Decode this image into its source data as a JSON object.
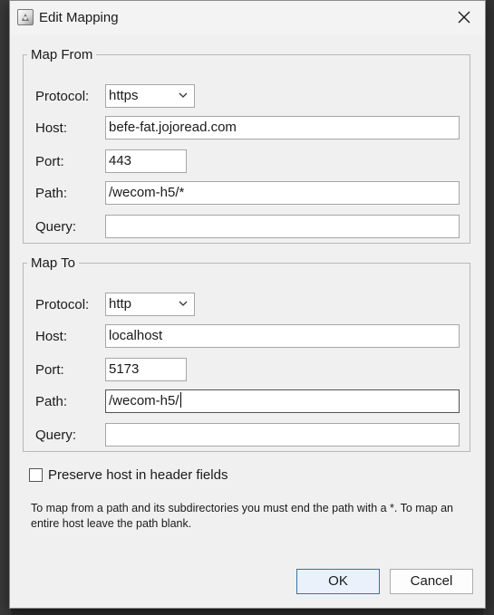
{
  "dialog": {
    "title": "Edit Mapping"
  },
  "map_from": {
    "legend": "Map From",
    "protocol_label": "Protocol:",
    "protocol_value": "https",
    "host_label": "Host:",
    "host_value": "befe-fat.jojoread.com",
    "port_label": "Port:",
    "port_value": "443",
    "path_label": "Path:",
    "path_value": "/wecom-h5/*",
    "query_label": "Query:",
    "query_value": ""
  },
  "map_to": {
    "legend": "Map To",
    "protocol_label": "Protocol:",
    "protocol_value": "http",
    "host_label": "Host:",
    "host_value": "localhost",
    "port_label": "Port:",
    "port_value": "5173",
    "path_label": "Path:",
    "path_value": "/wecom-h5/",
    "query_label": "Query:",
    "query_value": ""
  },
  "options": {
    "preserve_host_label": "Preserve host in header fields",
    "preserve_host_checked": false
  },
  "help_text": "To map from a path and its subdirectories you must end the path with a *. To map an entire host leave the path blank.",
  "buttons": {
    "ok": "OK",
    "cancel": "Cancel"
  },
  "icons": {
    "app": "app-icon",
    "close": "close-icon",
    "dropdown": "chevron-down-icon"
  }
}
